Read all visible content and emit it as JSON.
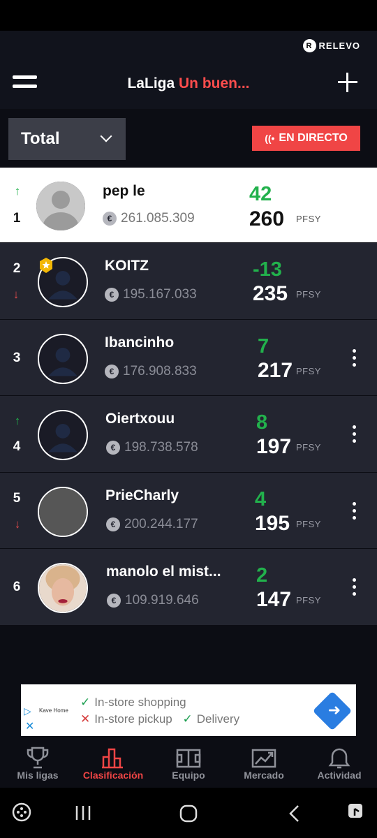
{
  "header": {
    "brand": "RELEVO",
    "brand_logo": "R",
    "title_main": "LaLiga",
    "title_accent": "Un buen...",
    "accent_color": "#ff4d4d"
  },
  "filter": {
    "selected": "Total",
    "live_label": "EN DIRECTO",
    "live_icon": "((•"
  },
  "ranking": [
    {
      "pos": "1",
      "trend": "up",
      "trend_icon": "↑",
      "name": "pep le",
      "money": "261.085.309",
      "delta": "42",
      "points": "260",
      "unit": "PFSY",
      "me": true
    },
    {
      "pos": "2",
      "trend": "down",
      "trend_icon": "↓",
      "name": "KOITZ",
      "money": "195.167.033",
      "delta": "-13",
      "points": "235",
      "unit": "PFSY"
    },
    {
      "pos": "3",
      "trend": "none",
      "trend_icon": "",
      "name": "Ibancinho",
      "money": "176.908.833",
      "delta": "7",
      "points": "217",
      "unit": "PFSY"
    },
    {
      "pos": "4",
      "trend": "up",
      "trend_icon": "↑",
      "name": "Oiertxouu",
      "money": "198.738.578",
      "delta": "8",
      "points": "197",
      "unit": "PFSY"
    },
    {
      "pos": "5",
      "trend": "down",
      "trend_icon": "↓",
      "name": "PrieCharly",
      "money": "200.244.177",
      "delta": "4",
      "points": "195",
      "unit": "PFSY"
    },
    {
      "pos": "6",
      "trend": "none",
      "trend_icon": "",
      "name": "manolo el mist...",
      "money": "109.919.646",
      "delta": "2",
      "points": "147",
      "unit": "PFSY"
    }
  ],
  "ad": {
    "brand": "Kave Home",
    "line1": "In-store shopping",
    "line2a": "In-store pickup",
    "line2b": "Delivery"
  },
  "tabs": [
    {
      "label": "Mis ligas",
      "icon": "trophy-icon"
    },
    {
      "label": "Clasificación",
      "icon": "bar-chart-icon",
      "active": true
    },
    {
      "label": "Equipo",
      "icon": "field-icon"
    },
    {
      "label": "Mercado",
      "icon": "market-icon"
    },
    {
      "label": "Actividad",
      "icon": "bell-icon"
    }
  ],
  "colors": {
    "up": "#22b14c",
    "down": "#e04b4b",
    "live": "#f04545"
  }
}
